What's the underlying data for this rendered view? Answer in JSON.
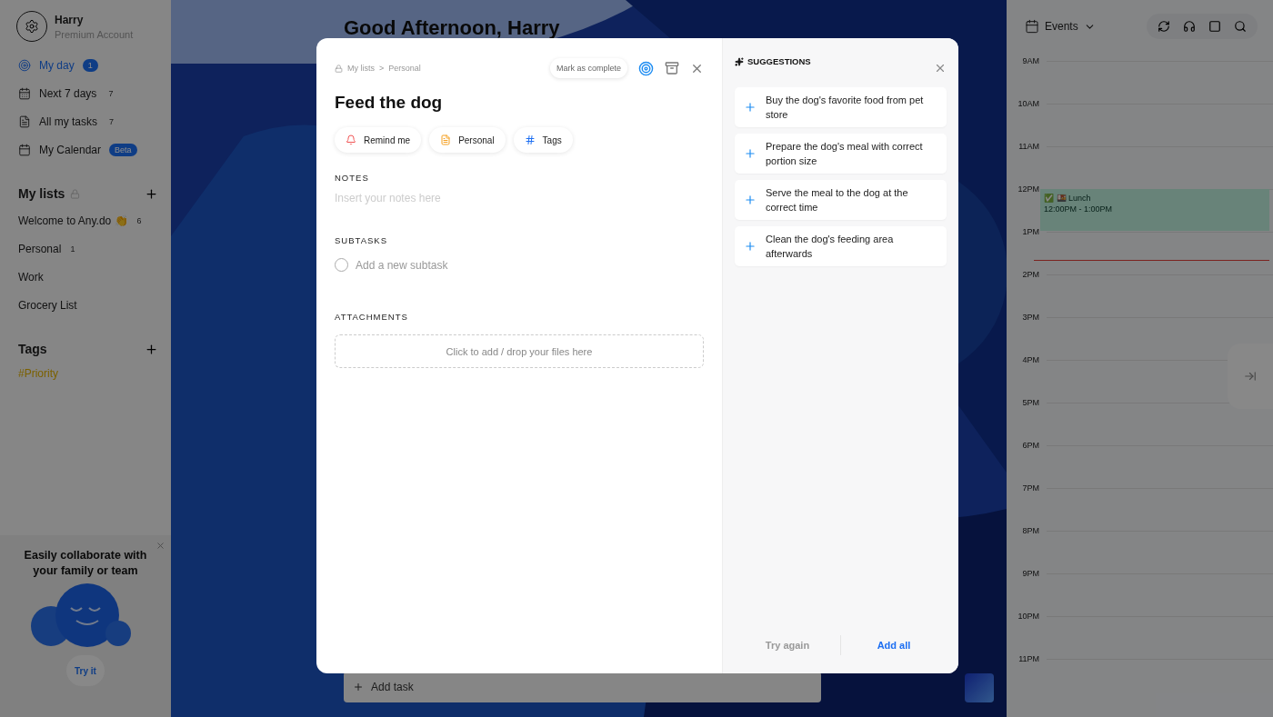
{
  "sidebar": {
    "user": {
      "name": "Harry",
      "plan": "Premium Account"
    },
    "nav": [
      {
        "kind": "today",
        "label": "My day",
        "count": "1",
        "selected": true
      },
      {
        "kind": "week",
        "label": "Next 7 days",
        "count": "7",
        "selected": false
      },
      {
        "kind": "tasks",
        "label": "All my tasks",
        "count": "7",
        "selected": false
      },
      {
        "kind": "calendar",
        "label": "My Calendar",
        "badge": "Beta",
        "selected": false
      }
    ],
    "lists_heading": "My lists",
    "lists": [
      {
        "label": "Welcome to Any.do 👏",
        "count": "6"
      },
      {
        "label": "Personal",
        "count": "1"
      },
      {
        "label": "Work"
      },
      {
        "label": "Grocery List"
      }
    ],
    "tags_heading": "Tags",
    "tags": [
      "#Priority"
    ],
    "promo": {
      "title": "Easily collaborate with your family or team",
      "button": "Try it"
    }
  },
  "main": {
    "greeting": "Good Afternoon, Harry",
    "add_task": {
      "placeholder": "Add task"
    }
  },
  "task_modal": {
    "breadcrumb": [
      "My lists",
      "Personal"
    ],
    "breadcrumb_separator": ">",
    "mark_complete": "Mark as complete",
    "title": "Feed the dog",
    "chips": [
      {
        "kind": "reminder",
        "label": "Remind me"
      },
      {
        "kind": "list",
        "label": "Personal"
      },
      {
        "kind": "tags",
        "label": "Tags"
      }
    ],
    "notes": {
      "heading": "NOTES",
      "placeholder": "Insert your notes here"
    },
    "subtasks": {
      "heading": "SUBTASKS",
      "placeholder": "Add a new subtask",
      "checked": false
    },
    "attachments": {
      "heading": "ATTACHMENTS",
      "drop_hint": "Click to add / drop your files here"
    },
    "suggestions": {
      "heading": "SUGGESTIONS",
      "items": [
        "Buy the dog's favorite food from pet store",
        "Prepare the dog's meal with correct portion size",
        "Serve the meal to the dog at the correct time",
        "Clean the dog's feeding area afterwards"
      ],
      "try_again": "Try again",
      "add_all": "Add all"
    }
  },
  "calendar": {
    "view": "Events",
    "hours": [
      "9AM",
      "10AM",
      "11AM",
      "12PM",
      "1PM",
      "2PM",
      "3PM",
      "4PM",
      "5PM",
      "6PM",
      "7PM",
      "8PM",
      "9PM",
      "10PM",
      "11PM"
    ],
    "events": [
      {
        "title": "✅ 🍱 Lunch",
        "time": "12:00PM - 1:00PM"
      }
    ]
  }
}
